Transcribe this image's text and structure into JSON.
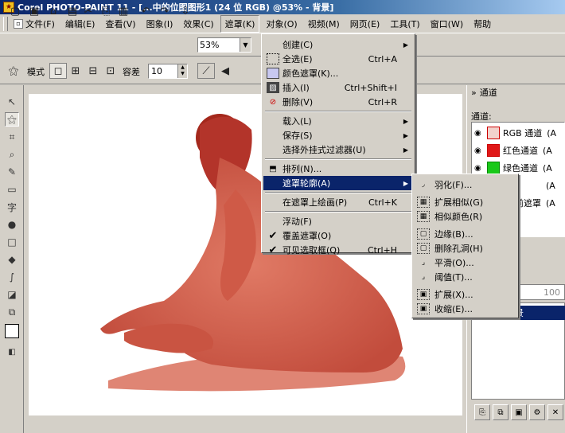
{
  "window": {
    "title": "Corel PHOTO-PAINT 11 - [...中的位图图形1 (24 位 RGB) @53% - 背景]"
  },
  "menubar": {
    "items": [
      {
        "label": "文件(F)"
      },
      {
        "label": "编辑(E)"
      },
      {
        "label": "查看(V)"
      },
      {
        "label": "图象(I)"
      },
      {
        "label": "效果(C)"
      },
      {
        "label": "遮罩(K)"
      },
      {
        "label": "对象(O)"
      },
      {
        "label": "视频(M)"
      },
      {
        "label": "网页(E)"
      },
      {
        "label": "工具(T)"
      },
      {
        "label": "窗口(W)"
      },
      {
        "label": "帮助"
      }
    ]
  },
  "toolbar": {
    "zoom": "53%"
  },
  "property_bar": {
    "mode_label": "模式",
    "tolerance_label": "容差",
    "tolerance_value": "10"
  },
  "mask_menu": {
    "items": [
      {
        "label": "创建(C)",
        "shortcut": "",
        "submenu": true
      },
      {
        "label": "全选(E)",
        "shortcut": "Ctrl+A"
      },
      {
        "label": "颜色遮罩(K)...",
        "shortcut": ""
      },
      {
        "label": "插入(I)",
        "shortcut": "Ctrl+Shift+I"
      },
      {
        "label": "删除(V)",
        "shortcut": "Ctrl+R"
      },
      {
        "label": "载入(L)",
        "shortcut": "",
        "submenu": true
      },
      {
        "label": "保存(S)",
        "shortcut": "",
        "submenu": true
      },
      {
        "label": "选择外挂式过滤器(U)",
        "shortcut": "",
        "submenu": true
      },
      {
        "label": "排列(N)...",
        "shortcut": ""
      },
      {
        "label": "遮罩轮廓(A)",
        "shortcut": "",
        "submenu": true
      },
      {
        "label": "在遮罩上绘画(P)",
        "shortcut": "Ctrl+K"
      },
      {
        "label": "浮动(F)",
        "shortcut": ""
      },
      {
        "label": "覆盖遮罩(O)",
        "shortcut": ""
      },
      {
        "label": "可见选取框(Q)",
        "shortcut": "Ctrl+H"
      }
    ]
  },
  "outline_submenu": {
    "items": [
      {
        "label": "羽化(F)..."
      },
      {
        "label": "扩展相似(G)"
      },
      {
        "label": "相似颜色(R)"
      },
      {
        "label": "边缘(B)..."
      },
      {
        "label": "删除孔洞(H)"
      },
      {
        "label": "平滑(O)..."
      },
      {
        "label": "阈值(T)..."
      },
      {
        "label": "扩展(X)..."
      },
      {
        "label": "收缩(E)..."
      }
    ]
  },
  "channels_docker": {
    "title": "通道",
    "list_label": "通道:",
    "channels": [
      {
        "label": "RGB 通道",
        "shortcut": "(A"
      },
      {
        "label": "红色通道",
        "shortcut": "(A"
      },
      {
        "label": "绿色通道",
        "shortcut": "(A"
      },
      {
        "label": "",
        "shortcut": "(A"
      },
      {
        "label": "前遮罩",
        "shortcut": "(A"
      }
    ]
  },
  "layers": {
    "opacity": "100",
    "layer_name": "背景"
  },
  "colors": {
    "accent": "#0a246a",
    "figure": "#d6604e"
  }
}
